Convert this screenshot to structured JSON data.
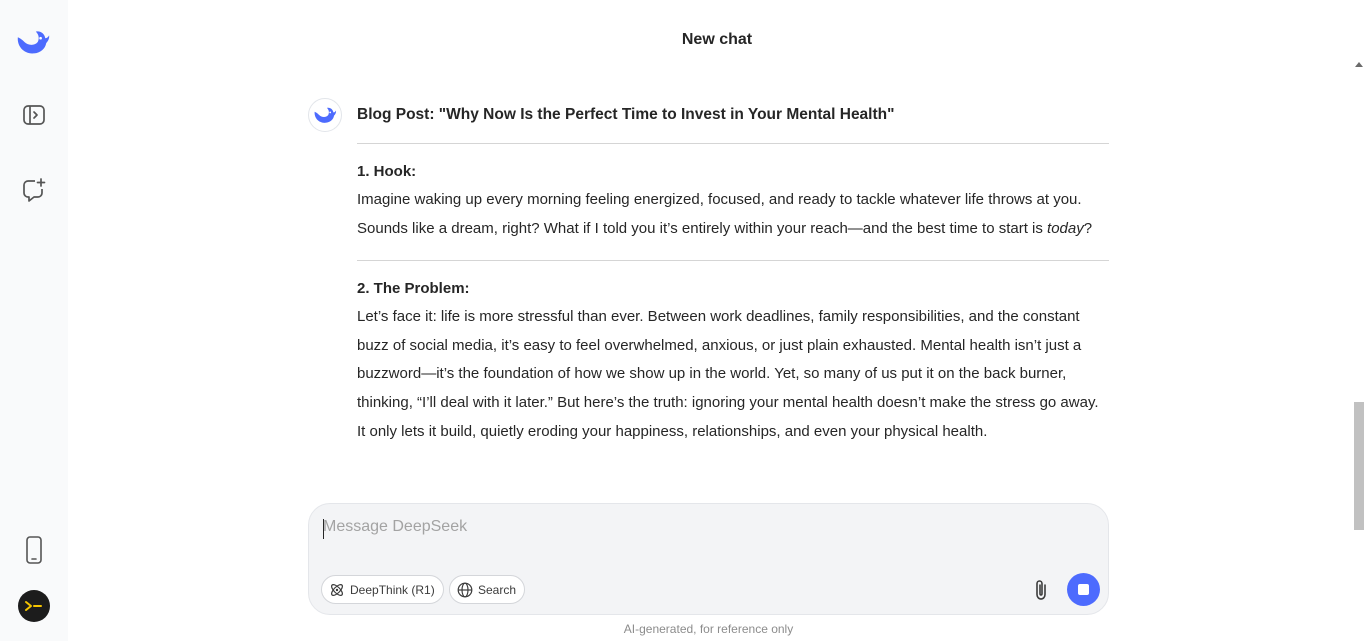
{
  "app": {
    "icon": "deepseek-whale-logo",
    "accent_color": "#4d6bfe"
  },
  "header": {
    "title": "New chat"
  },
  "sidebar": {
    "icons": [
      "deepseek-whale-logo",
      "sidebar-toggle-icon",
      "new-chat-icon",
      "mobile-phone-icon",
      "terminal-avatar"
    ]
  },
  "message": {
    "title": "Blog Post: \"Why Now Is the Perfect Time to Invest in Your Mental Health\"",
    "sections": [
      {
        "heading": "1. Hook:",
        "text_before": "Imagine waking up every morning feeling energized, focused, and ready to tackle whatever life throws at you. Sounds like a dream, right? What if I told you it’s entirely within your reach—and the best time to start is ",
        "text_italic": "today",
        "text_after": "?"
      },
      {
        "heading": "2. The Problem:",
        "text": "Let’s face it: life is more stressful than ever. Between work deadlines, family responsibilities, and the constant buzz of social media, it’s easy to feel overwhelmed, anxious, or just plain exhausted. Mental health isn’t just a buzzword—it’s the foundation of how we show up in the world. Yet, so many of us put it on the back burner, thinking, “I’ll deal with it later.” But here’s the truth: ignoring your mental health doesn’t make the stress go away. It only lets it build, quietly eroding your happiness, relationships, and even your physical health."
      }
    ]
  },
  "composer": {
    "placeholder": "Message DeepSeek",
    "value": "",
    "deepthink_label": "DeepThink (R1)",
    "search_label": "Search"
  },
  "footer": {
    "note": "AI-generated, for reference only"
  }
}
